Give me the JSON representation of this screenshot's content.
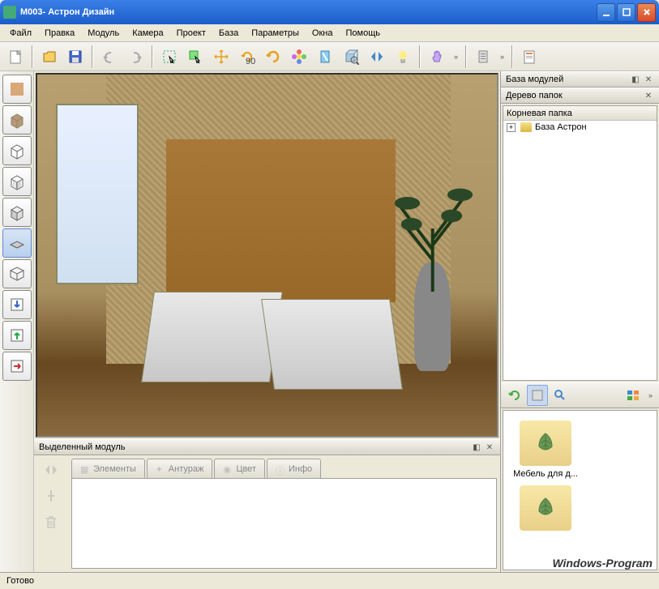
{
  "window": {
    "title": "М003- Астрон Дизайн"
  },
  "menu": {
    "items": [
      "Файл",
      "Правка",
      "Модуль",
      "Камера",
      "Проект",
      "База",
      "Параметры",
      "Окна",
      "Помощь"
    ]
  },
  "toolbar": {
    "groups": [
      [
        "new",
        "open",
        "save"
      ],
      [
        "undo",
        "redo"
      ],
      [
        "select-rect",
        "select-arrow",
        "move",
        "rotate-90",
        "rotate-free",
        "flower",
        "mirror",
        "view3d",
        "flip-h",
        "light"
      ],
      [
        "pan"
      ],
      [
        "doc"
      ],
      [
        "report"
      ]
    ],
    "expand": "»"
  },
  "left_tools": [
    "texture",
    "box-solid",
    "box-wire",
    "box-open",
    "box-iso",
    "plane-sel",
    "plane-iso",
    "import",
    "insert",
    "export"
  ],
  "panels": {
    "module_base": {
      "title": "База модулей"
    },
    "folder_tree": {
      "title": "Дерево папок",
      "root": "Корневая папка",
      "item1": "База Астрон"
    },
    "selected_module": {
      "title": "Выделенный модуль"
    }
  },
  "tabs": {
    "items": [
      {
        "label": "Элементы",
        "icon": "grid"
      },
      {
        "label": "Антураж",
        "icon": "star"
      },
      {
        "label": "Цвет",
        "icon": "palette"
      },
      {
        "label": "Инфо",
        "icon": "info"
      }
    ]
  },
  "thumbs": {
    "item1": {
      "label": "Мебель для д..."
    }
  },
  "status": {
    "text": "Готово"
  },
  "watermark": "Windows-Program"
}
